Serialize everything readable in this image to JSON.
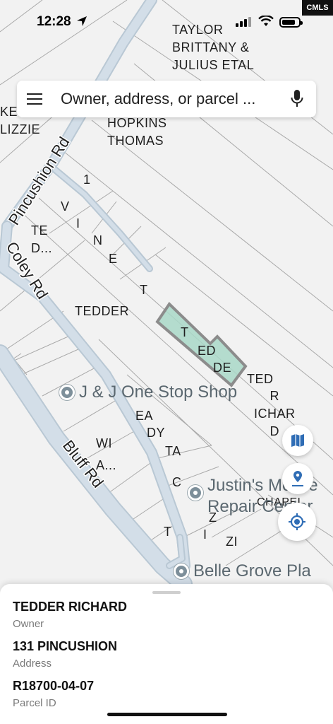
{
  "status_bar": {
    "time": "12:28",
    "watermark": "CMLS"
  },
  "search": {
    "placeholder": "Owner, address, or parcel ..."
  },
  "map": {
    "roads": [
      {
        "name": "Pincushion Rd"
      },
      {
        "name": "Coley Rd"
      },
      {
        "name": "Bluff Rd"
      }
    ],
    "owner_labels": [
      "TAYLOR\nBRITTANY &\nJULIUS ETAL",
      "KE\nLIZZIE",
      "HOPKINS\nTHOMAS",
      "TE\nD...",
      "TEDDER",
      "WI\nA...",
      "TED",
      "R\nICHAR\nD",
      "CHAPEL"
    ],
    "scattered_letters": [
      "1",
      "V",
      "I",
      "N",
      "E",
      "T",
      "EA",
      "DY",
      "TA",
      "C",
      "T",
      "I",
      "Z",
      "ZI"
    ],
    "selected_parcel_letters": [
      "T",
      "ED",
      "DE"
    ],
    "pois": [
      {
        "name": "J & J One Stop Shop"
      },
      {
        "name": "Justin's Mobile",
        "name2": "Repair Center"
      },
      {
        "name": "Belle Grove Pla"
      }
    ],
    "colors": {
      "background": "#f2f2f2",
      "road_fill": "#cfdbe4",
      "parcel_line": "#a9a9a9",
      "selected_fill": "#a9d8c8",
      "selected_stroke": "#8c8c8c"
    }
  },
  "buttons": {
    "map_layers_icon": "map-icon",
    "nearby_icon": "location-pin-icon",
    "my_location_icon": "crosshair-icon"
  },
  "parcel": {
    "owner": "TEDDER RICHARD",
    "owner_label": "Owner",
    "address": "131 PINCUSHION",
    "address_label": "Address",
    "parcel_id": "R18700-04-07",
    "parcel_id_label": "Parcel ID"
  }
}
